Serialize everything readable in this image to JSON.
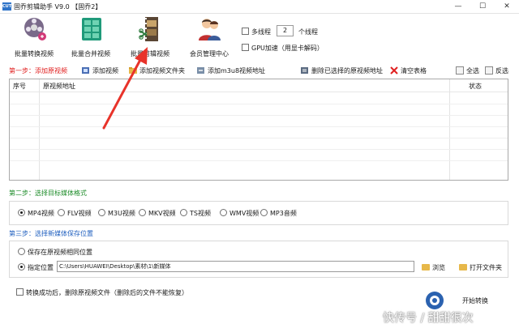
{
  "window": {
    "icon_text": "CUT",
    "title": "固乔剪辑助手 V9.0 【固乔2】",
    "min_glyph": "—",
    "max_glyph": "☐",
    "close_glyph": "✕"
  },
  "toolbar": {
    "tools": [
      {
        "label": "批量转换视频",
        "icon": "film-reel-icon"
      },
      {
        "label": "批量合并视频",
        "icon": "merge-grid-icon"
      },
      {
        "label": "批量剪辑视频",
        "icon": "film-strip-icon"
      },
      {
        "label": "会员管理中心",
        "icon": "members-icon"
      }
    ],
    "multithread_label": "多线程",
    "thread_count": "2",
    "thread_unit": "个线程",
    "gpu_label": "GPU加速（用显卡解码）"
  },
  "step1": {
    "title": "第一步：添加原视频",
    "buttons": {
      "add_video": "添加视频",
      "add_folder": "添加视频文件夹",
      "add_m3u8": "添加m3u8视频地址",
      "delete_selected": "删除已选择的原视频地址",
      "clear_table": "清空表格",
      "select_all": "全选",
      "invert": "反选"
    },
    "table": {
      "columns": [
        "序号",
        "原视频地址",
        "状态"
      ]
    }
  },
  "step2": {
    "title": "第二步：选择目标媒体格式",
    "formats": [
      "MP4视频",
      "FLV视频",
      "M3U视频",
      "MKV视频",
      "TS视频",
      "WMV视频",
      "MP3音频"
    ],
    "selected": "MP4视频"
  },
  "step3": {
    "title": "第三步：选择新媒体保存位置",
    "option_same": "保存在原视频相同位置",
    "option_custom": "指定位置",
    "path": "C:\\Users\\HUAWEI\\Desktop\\素材\\1\\新媒体",
    "browse": "浏览",
    "open_folder": "打开文件夹"
  },
  "footer": {
    "delete_after": "转换成功后，删除原视频文件（删除后的文件不能恢复）",
    "start": "开始转换",
    "watermark": "快传号 / 甜甜很次"
  },
  "colors": {
    "step1": "#e02020",
    "step2": "#1e8c2a",
    "step3": "#1f5fbf",
    "annotation_arrow": "#e8332a"
  }
}
